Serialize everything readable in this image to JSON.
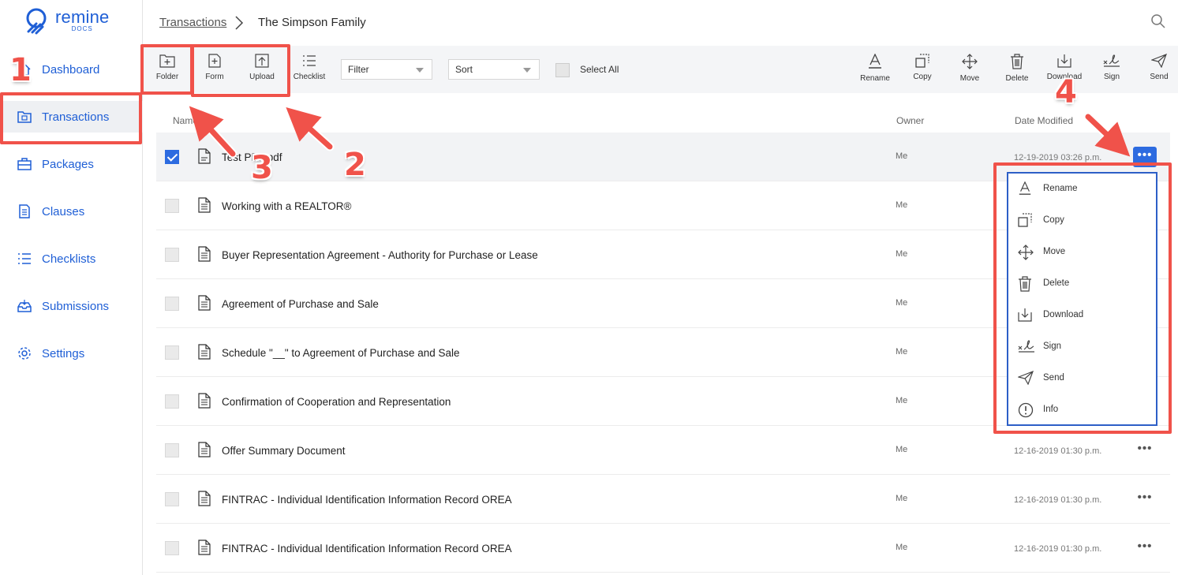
{
  "app": {
    "logo_word": "remine",
    "logo_sub": "DOCS",
    "accent_color": "#1f5fd6",
    "annotation_color": "#f0524a"
  },
  "sidebar": {
    "items": [
      {
        "label": "Dashboard",
        "icon": "home-icon"
      },
      {
        "label": "Transactions",
        "icon": "folder-icon",
        "active": true
      },
      {
        "label": "Packages",
        "icon": "briefcase-icon"
      },
      {
        "label": "Clauses",
        "icon": "document-icon"
      },
      {
        "label": "Checklists",
        "icon": "list-icon"
      },
      {
        "label": "Submissions",
        "icon": "inbox-icon"
      },
      {
        "label": "Settings",
        "icon": "gear-icon"
      }
    ]
  },
  "breadcrumb": {
    "parent": "Transactions",
    "current": "The Simpson Family"
  },
  "toolbar": {
    "folder": "Folder",
    "form": "Form",
    "upload": "Upload",
    "checklist": "Checklist",
    "filter": "Filter",
    "sort": "Sort",
    "select_all": "Select All",
    "rename": "Rename",
    "copy": "Copy",
    "move": "Move",
    "delete": "Delete",
    "download": "Download",
    "sign": "Sign",
    "send": "Send"
  },
  "table": {
    "headers": {
      "name": "Name",
      "owner": "Owner",
      "date": "Date Modified"
    },
    "rows": [
      {
        "name": "Test PDF.pdf",
        "owner": "Me",
        "date": "12-19-2019 03:26 p.m.",
        "selected": true
      },
      {
        "name": "Working with a REALTOR®",
        "owner": "Me",
        "date": ""
      },
      {
        "name": "Buyer Representation Agreement - Authority for Purchase or Lease",
        "owner": "Me",
        "date": ""
      },
      {
        "name": "Agreement of Purchase and Sale",
        "owner": "Me",
        "date": ""
      },
      {
        "name": "Schedule \"__\" to Agreement of Purchase and Sale",
        "owner": "Me",
        "date": ""
      },
      {
        "name": "Confirmation of Cooperation and Representation",
        "owner": "Me",
        "date": ""
      },
      {
        "name": "Offer Summary Document",
        "owner": "Me",
        "date": "12-16-2019 01:30 p.m."
      },
      {
        "name": "FINTRAC - Individual Identification Information Record OREA",
        "owner": "Me",
        "date": "12-16-2019 01:30 p.m."
      },
      {
        "name": "FINTRAC - Individual Identification Information Record OREA",
        "owner": "Me",
        "date": "12-16-2019 01:30 p.m."
      }
    ],
    "more_glyph": "•••"
  },
  "context_menu": {
    "items": [
      "Rename",
      "Copy",
      "Move",
      "Delete",
      "Download",
      "Sign",
      "Send",
      "Info"
    ]
  },
  "annotations": {
    "n1": "1",
    "n2": "2",
    "n3": "3",
    "n4": "4"
  }
}
